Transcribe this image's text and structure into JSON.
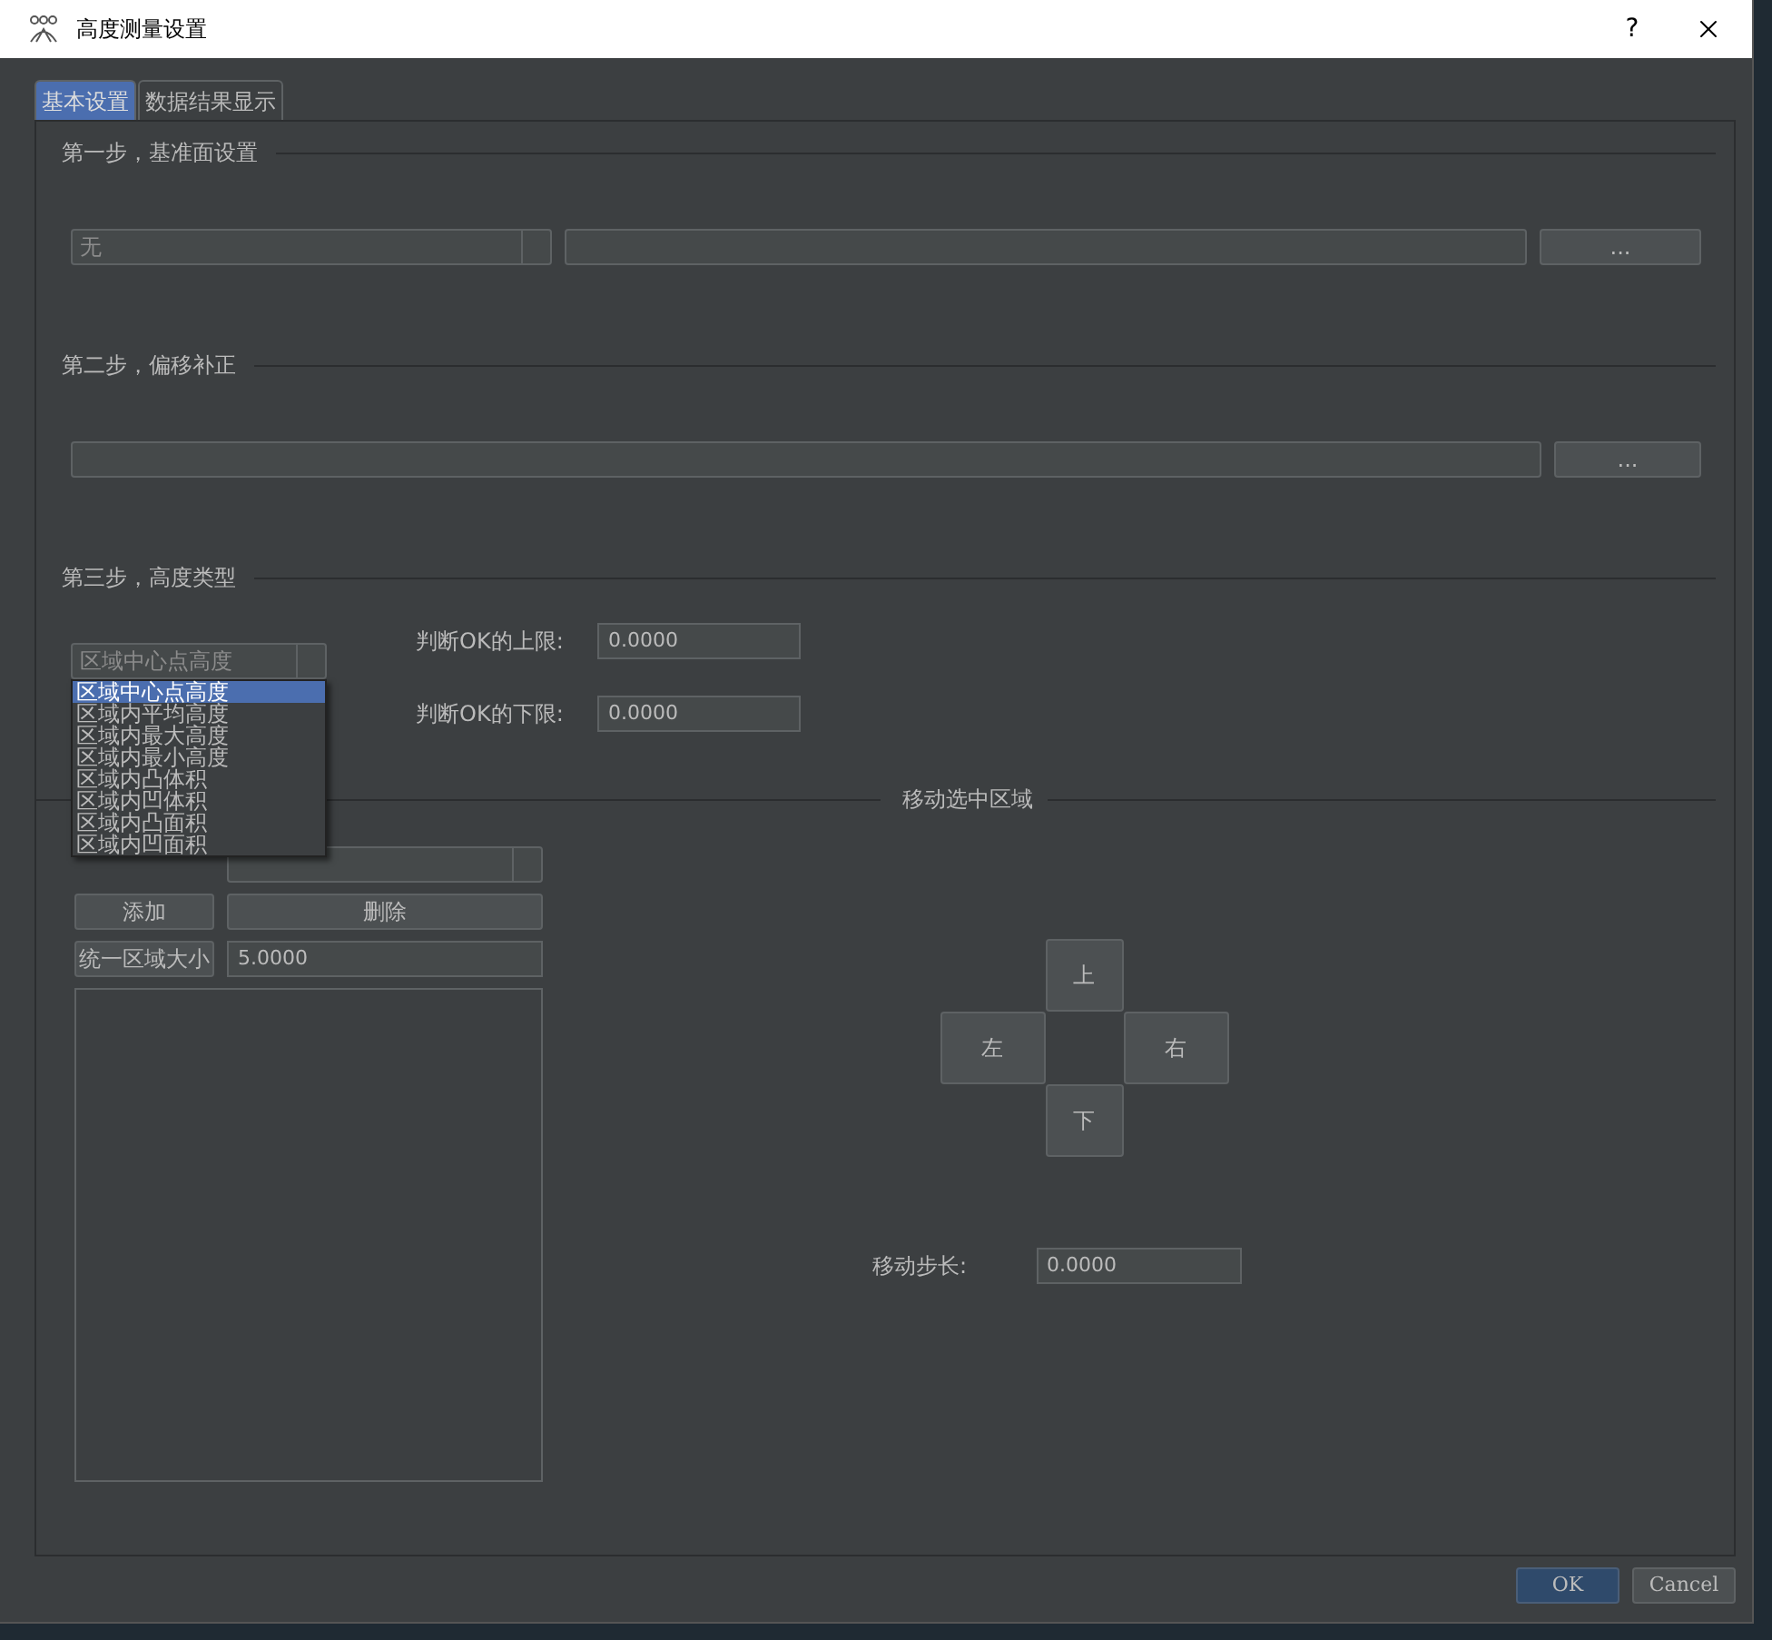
{
  "window": {
    "title": "高度测量设置",
    "help": "?"
  },
  "tabs": [
    {
      "label": "基本设置",
      "selected": true
    },
    {
      "label": "数据结果显示",
      "selected": false
    }
  ],
  "step1": {
    "title": "第一步，基准面设置",
    "combo_value": "无",
    "browse": "..."
  },
  "step2": {
    "title": "第二步，偏移补正",
    "browse": "..."
  },
  "step3": {
    "title": "第三步，高度类型",
    "combo_value": "区域中心点高度",
    "options": [
      {
        "label": "区域中心点高度",
        "selected": true
      },
      {
        "label": "区域内平均高度",
        "selected": false
      },
      {
        "label": "区域内最大高度",
        "selected": false
      },
      {
        "label": "区域内最小高度",
        "selected": false
      },
      {
        "label": "区域内凸体积",
        "selected": false
      },
      {
        "label": "区域内凹体积",
        "selected": false
      },
      {
        "label": "区域内凸面积",
        "selected": false
      },
      {
        "label": "区域内凹面积",
        "selected": false
      }
    ],
    "upper_label": "判断OK的上限:",
    "upper_value": "0.0000",
    "lower_label": "判断OK的下限:",
    "lower_value": "0.0000"
  },
  "regions": {
    "add": "添加",
    "delete": "删除",
    "uniform_size": "统一区域大小",
    "size_value": "5.0000"
  },
  "move": {
    "title": "移动选中区域",
    "up": "上",
    "left": "左",
    "right": "右",
    "down": "下",
    "step_label": "移动步长:",
    "step_value": "0.0000"
  },
  "buttons": [
    {
      "label": "OK",
      "kind": "primary"
    },
    {
      "label": "Cancel",
      "kind": "secondary"
    }
  ]
}
